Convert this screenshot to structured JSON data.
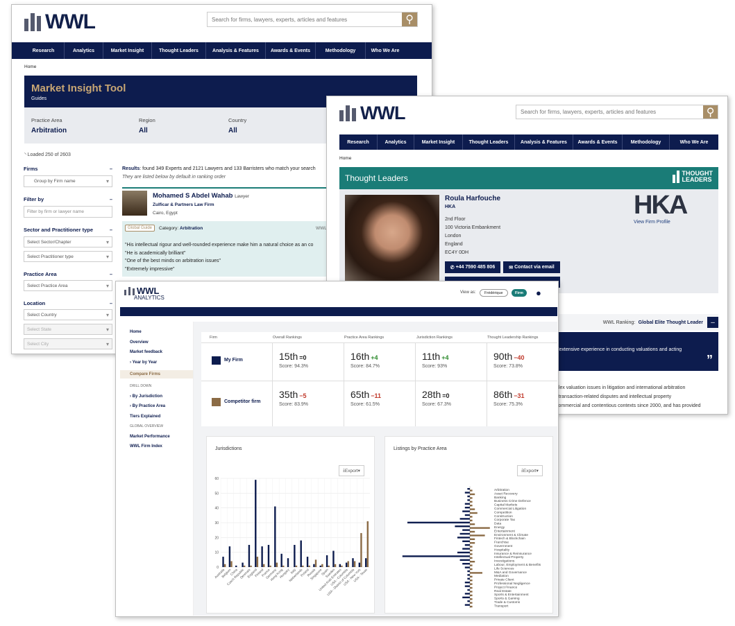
{
  "site": {
    "brand": "WWL",
    "search_placeholder": "Search for firms, lawyers, experts, articles and features",
    "nav": [
      "Research",
      "Analytics",
      "Market Insight",
      "Thought Leaders",
      "Analysis & Features",
      "Awards & Events",
      "Methodology",
      "Who We Are"
    ],
    "breadcrumb": "Home"
  },
  "market_insight": {
    "title": "Market Insight Tool",
    "subtitle": "Guides",
    "filters": [
      {
        "label": "Practice Area",
        "value": "Arbitration"
      },
      {
        "label": "Region",
        "value": "All"
      },
      {
        "label": "Country",
        "value": "All"
      }
    ],
    "loaded": "Loaded 250 of 2603",
    "results_label": "Results",
    "results_text": ": found 349 Experts and 2121 Lawyers and 133 Barristers who match your search",
    "results_sub": "They are listed below by default in ranking order",
    "sidebar": {
      "firms_h": "Firms",
      "group_label": "Group by Firm name",
      "filter_h": "Filter by",
      "filter_placeholder": "Filter by firm or lawyer name",
      "sector_h": "Sector and Practitioner type",
      "sector_sel": "Select Sector/Chapter",
      "pract_sel": "Select Practitioner type",
      "pa_h": "Practice Area",
      "pa_sel": "Select Practice Area",
      "loc_h": "Location",
      "country_sel": "Select Country",
      "state_sel": "Select State",
      "city_sel": "Select City"
    },
    "result": {
      "name": "Mohamed S Abdel Wahab",
      "role": "Lawyer",
      "firm": "Zulficar & Partners Law Firm",
      "city": "Cairo, Egypt",
      "badge": "Global Guide",
      "category_label": "Category:",
      "category": "Arbitration",
      "tag": "WWL",
      "quotes": [
        "\"His intellectual rigour and well-rounded experience make him a natural choice as an co",
        "\"He is academically brilliant\"",
        "\"One of the best minds on arbitration issues\"",
        "\"Extremely impressive\""
      ]
    }
  },
  "thought_leaders": {
    "title": "Thought Leaders",
    "badge": [
      "THOUGHT",
      "LEADERS"
    ],
    "name": "Roula Harfouche",
    "org": "HKA",
    "address": [
      "2nd Floor",
      "100 Victoria Embankment",
      "London",
      "England",
      "EC4Y 0DH"
    ],
    "phone": "+44 7590 485 806",
    "email_btn": "Contact via email",
    "firm_logo": "HKA",
    "view_profile": "View Firm Profile",
    "ranking_label": "WWL Ranking:",
    "ranking": "Global Elite Thought Leader",
    "quote": "\"extensive experience in conducting valuations and acting",
    "bio": [
      "plex valuation issues in litigation and international arbitration",
      ", transaction-related disputes and intellectual property",
      "commercial and contentious contexts since 2000, and has provided"
    ]
  },
  "analytics": {
    "brand": "WWL",
    "brand_sub": "ANALYTICS",
    "view_as": "View as:",
    "toggle": [
      "Frédérique",
      "Firm"
    ],
    "menu": [
      "Home",
      "Overview",
      "Market feedback",
      "Year by Year",
      "Compare Firms"
    ],
    "drill_h": "DRILL DOWN",
    "drill": [
      "By Jurisdiction",
      "By Practice Area",
      "Tiers Explained"
    ],
    "global_h": "GLOBAL OVERVIEW",
    "global": [
      "Market Performance",
      "WWL Firm Index"
    ],
    "columns": [
      "Firm",
      "Overall Rankings",
      "Practice Area Rankings",
      "Jurisdiction Rankings",
      "Thought Leadership Rankings"
    ],
    "rows": [
      {
        "name": "My Firm",
        "color": "#0d1c4e",
        "cells": [
          [
            "15th",
            "=0",
            "Score: 94.3%"
          ],
          [
            "16th",
            "+4",
            "Score: 84.7%"
          ],
          [
            "11th",
            "+4",
            "Score: 93%"
          ],
          [
            "90th",
            "−40",
            "Score: 73.8%"
          ]
        ]
      },
      {
        "name": "Competitor firm",
        "color": "#8b6b45",
        "cells": [
          [
            "35th",
            "−5",
            "Score: 83.9%"
          ],
          [
            "65th",
            "−11",
            "Score: 61.5%"
          ],
          [
            "28th",
            "=0",
            "Score: 67.3%"
          ],
          [
            "86th",
            "−31",
            "Score: 75.3%"
          ]
        ]
      }
    ],
    "export": "Export",
    "colors": {
      "navy": "#0d1c4e",
      "brown": "#8b6b45",
      "pos": "#2e8b2e",
      "neg": "#c0392b"
    }
  },
  "chart_data": [
    {
      "type": "bar",
      "title": "Jurisdictions",
      "categories": [
        "Australia",
        "Belgium",
        "China",
        "Czech Republic",
        "Denmark",
        "England",
        "Finland",
        "France",
        "Germany",
        "Hong Kong",
        "Hungary",
        "Italy",
        "Netherlands",
        "Poland",
        "Russia",
        "Singapore",
        "Spain",
        "Sweden",
        "United Arab Emirates",
        "USA - Columbia",
        "USA - District of Columbia",
        "USA - New York",
        "USA - Texas"
      ],
      "series": [
        {
          "values": [
            7,
            14,
            1,
            3,
            15,
            59,
            14,
            15,
            41,
            9,
            6,
            15,
            18,
            7,
            2,
            1,
            8,
            11,
            2,
            3,
            6,
            3,
            6
          ]
        },
        {
          "values": [
            2,
            4,
            0,
            1,
            1,
            7,
            2,
            1,
            3,
            1,
            0,
            1,
            1,
            1,
            5,
            2,
            1,
            2,
            1,
            4,
            4,
            23,
            31
          ]
        }
      ],
      "ylim": [
        0,
        60
      ],
      "yticks": [
        0,
        10,
        20,
        30,
        40,
        50,
        60
      ]
    },
    {
      "type": "bar",
      "title": "Listings by Practice Area",
      "orientation": "horizontal",
      "categories": [
        "Arbitration",
        "Asset Recovery",
        "Banking",
        "Business Crime Defence",
        "Capital Markets",
        "Commercial Litigation",
        "Competition",
        "Construction",
        "Corporate Tax",
        "Data",
        "Energy",
        "Entertainment",
        "Environment & Climate",
        "Fintech & Blockchain",
        "Franchise",
        "Government",
        "Hospitality",
        "Insurance & Reinsurance",
        "Intellectual Property",
        "Investigations",
        "Labour, Employment & Benefits",
        "Life Sciences",
        "M&A and Governance",
        "Mediation",
        "Private Client",
        "Professional Negligence",
        "Project Finance",
        "Real Estate",
        "Sports & Entertainment",
        "Sports & Gaming",
        "Trade & Customs",
        "Transport"
      ],
      "series": [
        {
          "values": [
            -1,
            -2,
            -1,
            -1,
            -2,
            -2,
            -3,
            -2,
            -4,
            -25,
            -6,
            -3,
            -4,
            -5,
            -3,
            -2,
            -3,
            -5,
            -27,
            -4,
            -3,
            -2,
            -1,
            -1,
            -1,
            -2,
            -2,
            -1,
            -2,
            -3,
            -1,
            -2
          ]
        },
        {
          "values": [
            1,
            2,
            1,
            1,
            1,
            2,
            3,
            1,
            1,
            2,
            8,
            2,
            6,
            2,
            2,
            1,
            1,
            1,
            1,
            2,
            1,
            1,
            5,
            1,
            1,
            1,
            1,
            1,
            1,
            1,
            1,
            1
          ]
        }
      ]
    }
  ]
}
